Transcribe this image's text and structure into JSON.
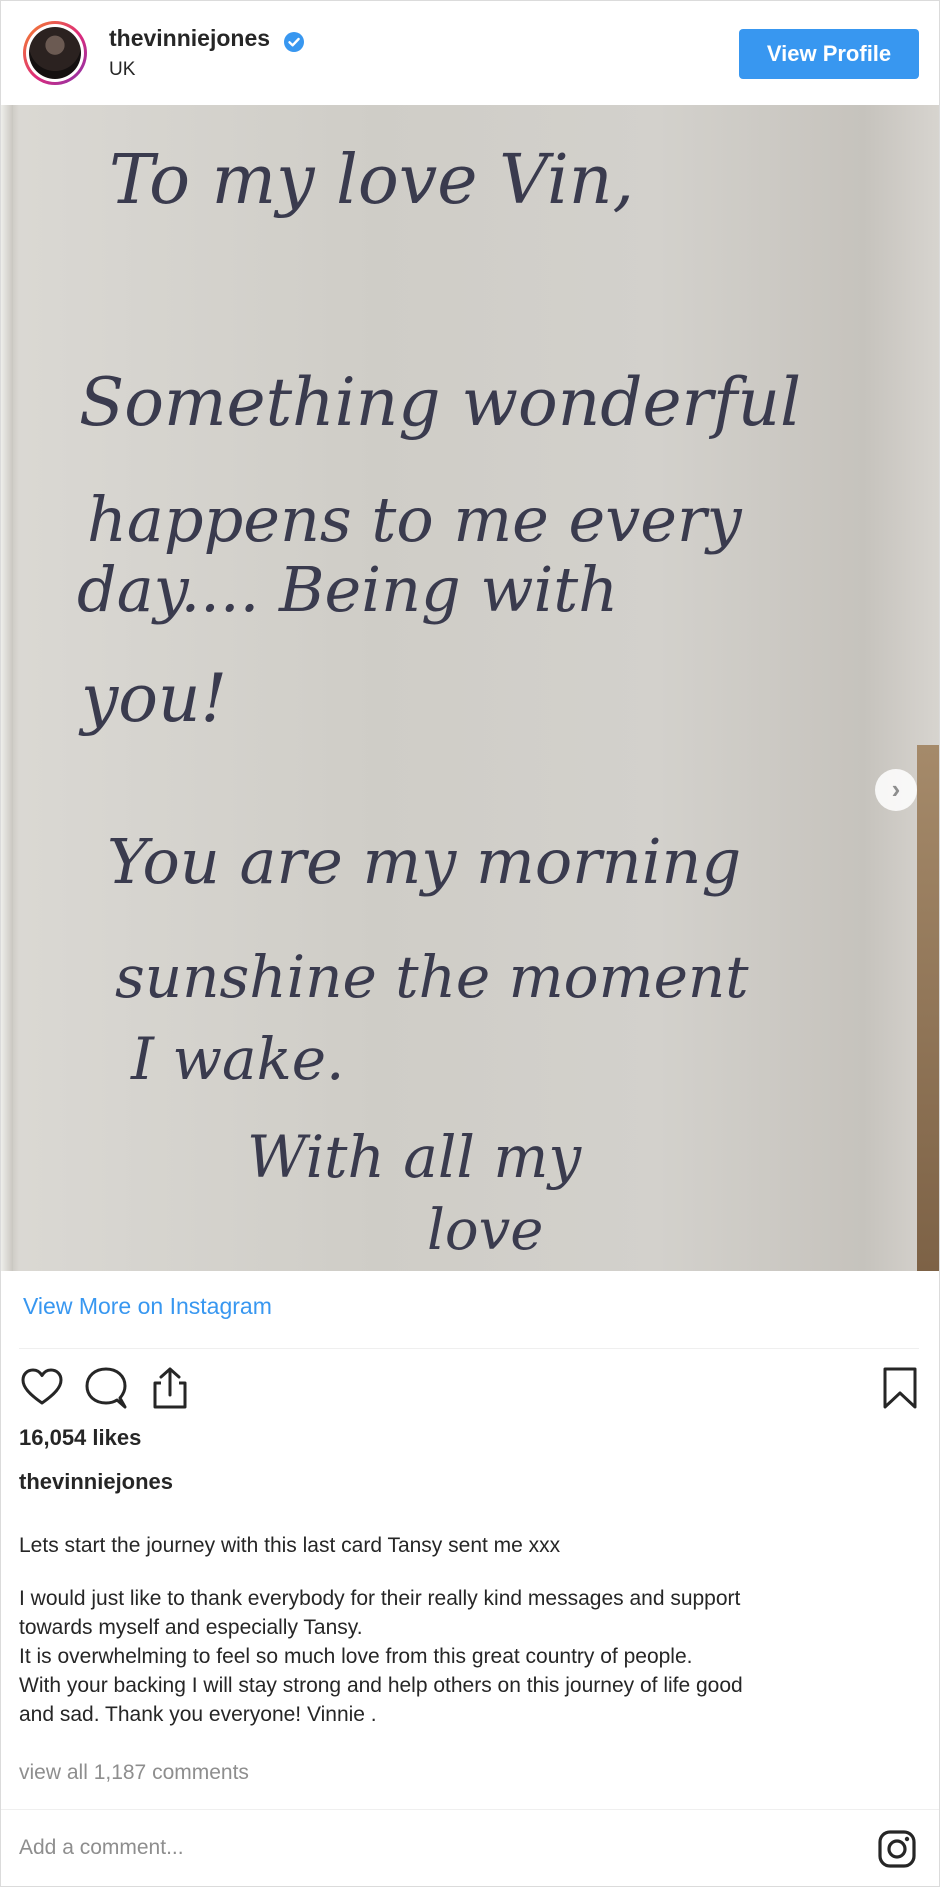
{
  "header": {
    "username": "thevinniejones",
    "verified_icon": "verified-badge-icon",
    "location": "UK",
    "view_profile_label": "View Profile"
  },
  "post": {
    "image_description_icon": "handwritten-card-photo",
    "handwriting_lines": [
      "To my love Vin,",
      "Something wonderful",
      "happens to me every",
      "day.... Being with",
      "you!",
      "You are my morning",
      "sunshine the moment",
      "I wake.",
      "With all my",
      "love"
    ],
    "carousel": {
      "current": 1,
      "total": 2,
      "next_icon": "chevron-right-icon"
    }
  },
  "links": {
    "view_more": "View More on Instagram"
  },
  "actions": {
    "like_icon": "heart-icon",
    "comment_icon": "comment-icon",
    "share_icon": "share-icon",
    "save_icon": "bookmark-icon"
  },
  "likes": "16,054 likes",
  "caption": {
    "username": "thevinniejones",
    "paragraph1": "Lets start the journey with this last card Tansy sent me xxx",
    "lines": [
      "I would just like to thank everybody for their really kind messages and support",
      "towards myself and especially Tansy.",
      "It is overwhelming to feel so much love from this great country of people.",
      "With your backing I will stay strong and help others on this journey of life good",
      "and sad. Thank you everyone! Vinnie ."
    ]
  },
  "comments_link": "view all 1,187 comments",
  "comment_input": {
    "placeholder": "Add a comment..."
  },
  "footer": {
    "instagram_icon": "instagram-logo-icon"
  },
  "colors": {
    "accent": "#3897f0",
    "text": "#262626",
    "muted": "#8e8e8e",
    "ink": "#3a3b4e"
  }
}
